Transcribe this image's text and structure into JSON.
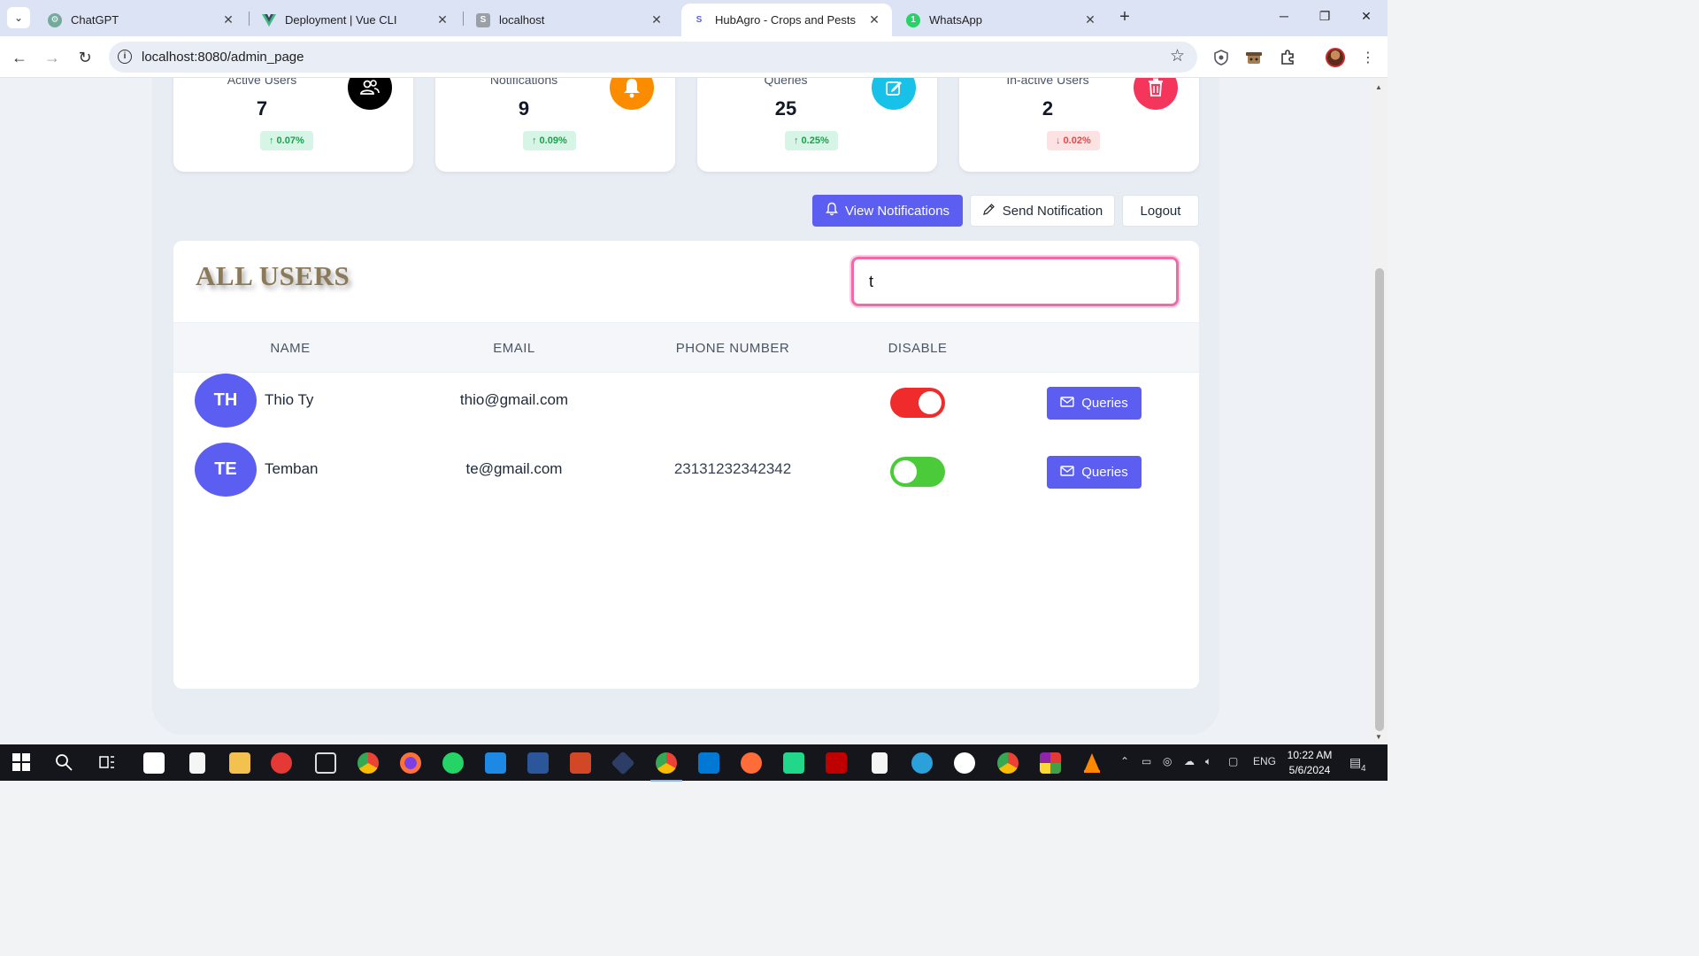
{
  "browser": {
    "tabs": [
      {
        "title": "ChatGPT",
        "icon": "chatgpt-icon",
        "color": "#74aa9c"
      },
      {
        "title": "Deployment | Vue CLI",
        "icon": "vue-icon",
        "color": "#42b883"
      },
      {
        "title": "localhost",
        "icon": "s-icon",
        "color": "#9aa0a6"
      },
      {
        "title": "HubAgro - Crops and Pests",
        "icon": "s-icon",
        "color": "#5b5ef0"
      },
      {
        "title": "WhatsApp",
        "icon": "whatsapp-icon",
        "color": "#25d366",
        "badge": "1"
      }
    ],
    "url": "localhost:8080/admin_page"
  },
  "stats": [
    {
      "label": "Active Users",
      "value": "7",
      "change": "↑ 0.07%",
      "trend": "up",
      "icon": "users-icon",
      "icon_bg": "#000000"
    },
    {
      "label": "Notifications",
      "value": "9",
      "change": "↑ 0.09%",
      "trend": "up",
      "icon": "bell-icon",
      "icon_bg": "#fb8c00"
    },
    {
      "label": "Queries",
      "value": "25",
      "change": "↑ 0.25%",
      "trend": "up",
      "icon": "edit-icon",
      "icon_bg": "#17c1e8"
    },
    {
      "label": "In-active Users",
      "value": "2",
      "change": "↓ 0.02%",
      "trend": "down",
      "icon": "trash-icon",
      "icon_bg": "#f5365c"
    }
  ],
  "actions": {
    "view_notifications": "View Notifications",
    "send_notification": "Send Notification",
    "logout": "Logout"
  },
  "users": {
    "title": "ALL USERS",
    "search_value": "t",
    "columns": [
      "NAME",
      "EMAIL",
      "PHONE NUMBER",
      "DISABLE"
    ],
    "rows": [
      {
        "initials": "TH",
        "name": "Thio Ty",
        "email": "thio@gmail.com",
        "phone": "",
        "disabled": true,
        "action": "Queries"
      },
      {
        "initials": "TE",
        "name": "Temban",
        "email": "te@gmail.com",
        "phone": "23131232342342",
        "disabled": false,
        "action": "Queries"
      }
    ]
  },
  "taskbar": {
    "time": "10:22 AM",
    "date": "5/6/2024",
    "lang": "ENG",
    "notifications": "4"
  },
  "colors": {
    "accent": "#5b5ef0",
    "toggle_on": "#ef2b2b",
    "toggle_off": "#4ccb3a",
    "search_border": "#f06aaa"
  }
}
